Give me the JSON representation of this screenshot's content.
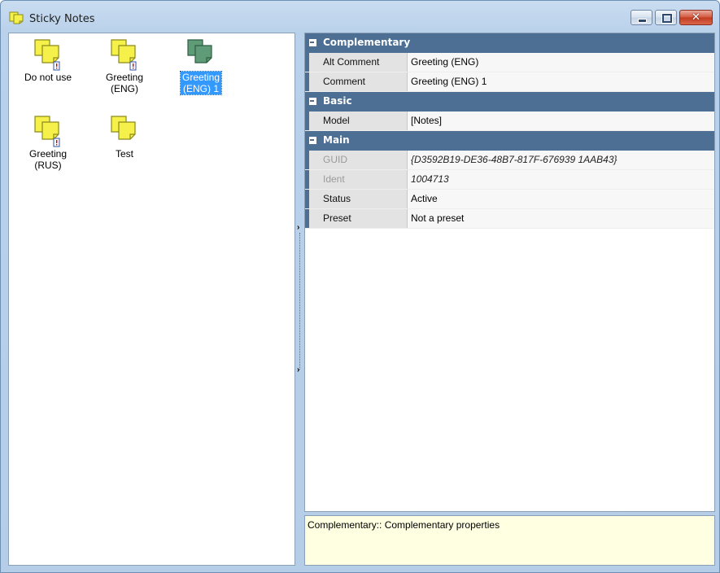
{
  "window": {
    "title": "Sticky Notes"
  },
  "notes": [
    {
      "label_line1": "Do not use",
      "label_line2": "",
      "selected": false,
      "has_badge": true,
      "color": "#f5f04a"
    },
    {
      "label_line1": "Greeting",
      "label_line2": "(ENG)",
      "selected": false,
      "has_badge": true,
      "color": "#f5f04a"
    },
    {
      "label_line1": "Greeting",
      "label_line2": "(ENG) 1",
      "selected": true,
      "has_badge": false,
      "color": "#5e9b76"
    },
    {
      "label_line1": "Greeting",
      "label_line2": "(RUS)",
      "selected": false,
      "has_badge": true,
      "color": "#f5f04a"
    },
    {
      "label_line1": "Test",
      "label_line2": "",
      "selected": false,
      "has_badge": false,
      "color": "#f5f04a"
    }
  ],
  "splitter": {
    "arrow_top": "›",
    "arrow_bottom": "›"
  },
  "properties": {
    "categories": [
      {
        "name": "Complementary",
        "rows": [
          {
            "name": "Alt Comment",
            "value": "Greeting (ENG)"
          },
          {
            "name": "Comment",
            "value": "Greeting (ENG) 1"
          }
        ]
      },
      {
        "name": "Basic",
        "rows": [
          {
            "name": "Model",
            "value": "[Notes]"
          }
        ]
      },
      {
        "name": "Main",
        "rows": [
          {
            "name": "GUID",
            "value": "{D3592B19-DE36-48B7-817F-676939 1AAB43}"
          },
          {
            "name": "Ident",
            "value": "1004713"
          },
          {
            "name": "Status",
            "value": "Active"
          },
          {
            "name": "Preset",
            "value": "Not a preset"
          }
        ]
      }
    ]
  },
  "help": {
    "text": "Complementary:: Complementary properties"
  },
  "colors": {
    "category_header": "#4d6f94",
    "selection": "#3399ff",
    "help_background": "#ffffe1"
  }
}
